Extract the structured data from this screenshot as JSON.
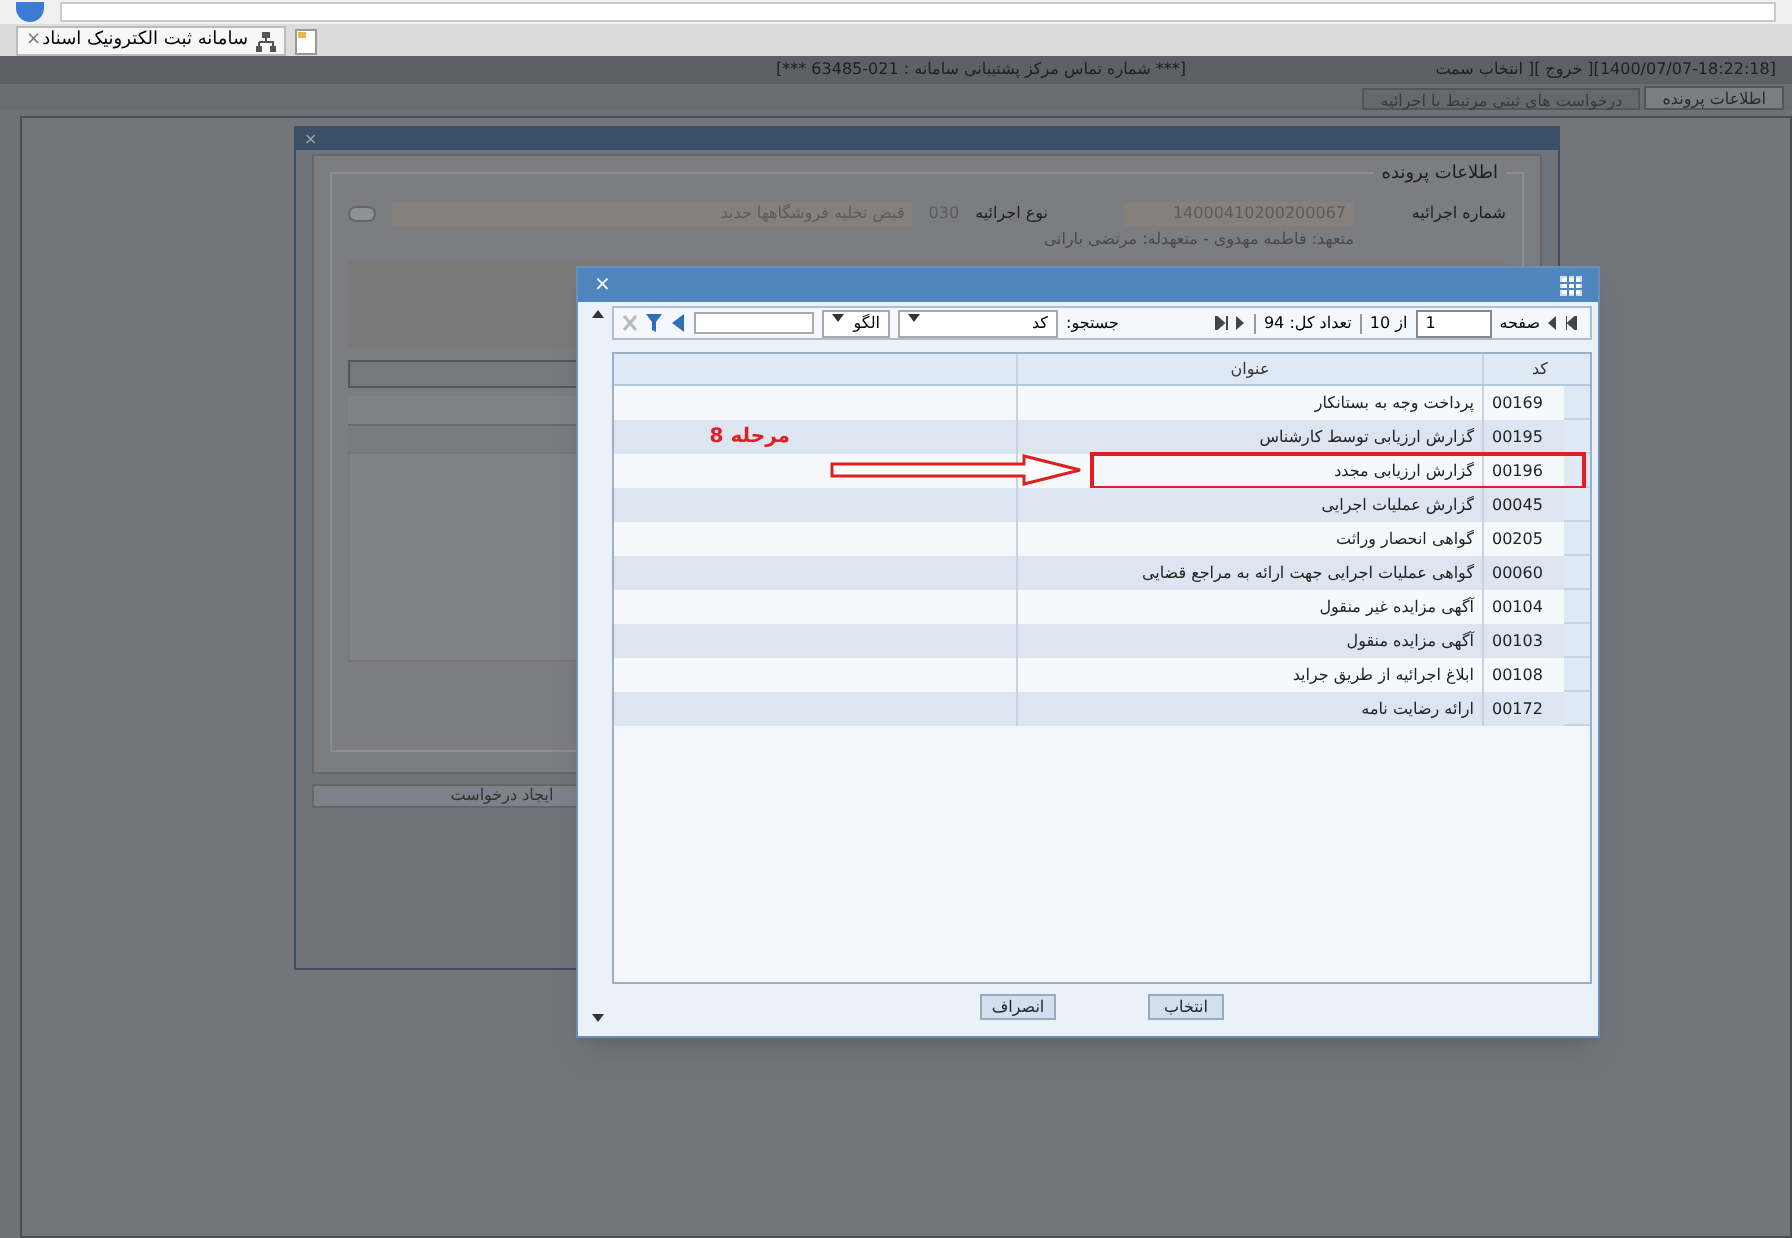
{
  "browser_tab": {
    "title": "سامانه ثبت الکترونیک اسناد",
    "close": "×"
  },
  "header": {
    "session": "[1400/07/07-18:22:18][ خروج ][ انتخاب سمت",
    "support": "[*** شماره تماس مرکز پشتیبانی سامانه : 021-63485 ***]"
  },
  "tabs": [
    {
      "label": "اطلاعات پرونده",
      "selected": true
    },
    {
      "label": "درخواست های ثبتی مرتبط با اجرائیه",
      "selected": false
    }
  ],
  "case_dialog": {
    "close": "×",
    "section": "اطلاعات پرونده",
    "number_label": "شماره اجرائیه",
    "number": "14000410200200067",
    "type_label": "نوع اجرائیه",
    "type_code": "030",
    "type_name": "قبض تخلیه فروشگاهها جدید",
    "parties": "متعهد: فاطمه مهدوی - متعهدله: مرتضی بارانی",
    "button": "ایجاد درخواست"
  },
  "picker": {
    "close": "×",
    "pager": {
      "page_label": "صفحه",
      "page": "1",
      "of": "از 10",
      "total": "تعداد کل: 94"
    },
    "search": {
      "label": "جستجو:",
      "field": "کد",
      "mode": "الگو"
    },
    "columns": [
      "کد",
      "عنوان"
    ],
    "rows": [
      {
        "code": "00169",
        "title": "پرداخت وجه به بستانکار"
      },
      {
        "code": "00195",
        "title": "گزارش ارزیابی توسط کارشناس"
      },
      {
        "code": "00196",
        "title": "گزارش ارزیابی مجدد",
        "annotated": true
      },
      {
        "code": "00045",
        "title": "گزارش عملیات اجرایی"
      },
      {
        "code": "00205",
        "title": "گواهی انحصار وراثت"
      },
      {
        "code": "00060",
        "title": "گواهی عملیات اجرایی جهت ارائه به مراجع قضایی"
      },
      {
        "code": "00104",
        "title": "آگهی مزایده غیر منقول"
      },
      {
        "code": "00103",
        "title": "آگهی مزایده منقول"
      },
      {
        "code": "00108",
        "title": "ابلاغ اجرائیه از طریق جراید"
      },
      {
        "code": "00172",
        "title": "ارائه رضایت نامه"
      }
    ],
    "annotation": {
      "label": "مرحله 8",
      "color": "#e02020"
    },
    "buttons": [
      "انتخاب",
      "انصراف"
    ]
  }
}
